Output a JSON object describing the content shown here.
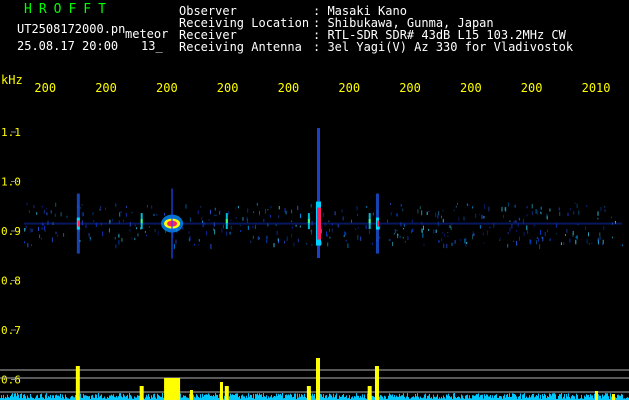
{
  "header": {
    "title": "HROFFT",
    "file": "UT2508172000.pn",
    "detect_label": "meteor",
    "datetime": "25.08.17 20:00",
    "count": "13_",
    "observer_label": "Observer",
    "observer_value": ": Masaki Kano",
    "location_label": "Receiving Location",
    "location_value": ": Shibukawa, Gunma, Japan",
    "receiver_label": "Receiver",
    "receiver_value": ": RTL-SDR SDR# 43dB L15 103.2MHz CW",
    "antenna_label": "Receiving Antenna",
    "antenna_value": ": 3el Yagi(V) Az 330 for Vladivostok"
  },
  "colors": {
    "title": "#00ff00",
    "text": "#ffffff",
    "axis": "#ffff00",
    "background": "#000000",
    "noise": "#00c8ff",
    "signal_hot": "#ff2060"
  },
  "chart_data": {
    "type": "heatmap",
    "xlabel": "",
    "ylabel": "kHz",
    "x_ticks": [
      "200",
      "200",
      "200",
      "200",
      "200",
      "200",
      "200",
      "200",
      "200",
      "2010"
    ],
    "y_ticks": [
      "1.1",
      "1.0",
      "0.9",
      "0.8",
      "0.7",
      "0.6"
    ],
    "ylim": [
      0.58,
      1.17
    ],
    "xlim": [
      0,
      10
    ],
    "carrier_khz": 0.915,
    "meteor_echoes": [
      {
        "x": 1.05,
        "khz": 0.915,
        "strength": "medium"
      },
      {
        "x": 2.1,
        "khz": 0.92,
        "strength": "weak"
      },
      {
        "x": 2.6,
        "khz": 0.915,
        "strength": "strong"
      },
      {
        "x": 3.5,
        "khz": 0.92,
        "strength": "weak"
      },
      {
        "x": 4.85,
        "khz": 0.92,
        "strength": "weak"
      },
      {
        "x": 5.0,
        "khz": 0.915,
        "strength": "very strong"
      },
      {
        "x": 5.85,
        "khz": 0.92,
        "strength": "weak"
      },
      {
        "x": 5.97,
        "khz": 0.915,
        "strength": "medium"
      }
    ]
  }
}
